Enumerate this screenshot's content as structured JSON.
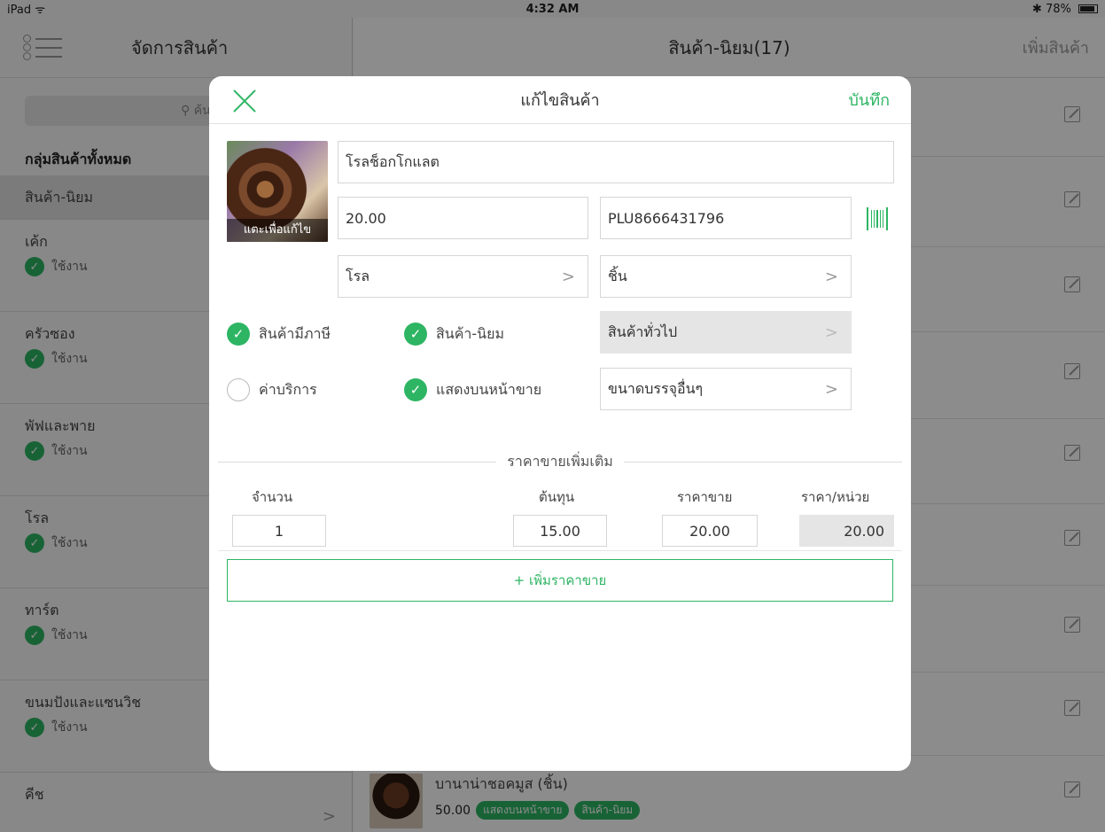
{
  "statusbar": {
    "device": "iPad",
    "wifi": "ᯤ",
    "time": "4:32 AM",
    "bluetooth": "✱",
    "battery": "78%"
  },
  "sidebar": {
    "title": "จัดการสินค้า",
    "search_placeholder": "ค้นหาสิน",
    "all_groups": "กลุ่มสินค้าทั้งหมด",
    "items": [
      {
        "name": "สินค้า-นิยม",
        "state": ""
      },
      {
        "name": "เค้ก",
        "state": "ใช้งาน"
      },
      {
        "name": "ครัวซอง",
        "state": "ใช้งาน"
      },
      {
        "name": "พัฟและพาย",
        "state": "ใช้งาน"
      },
      {
        "name": "โรล",
        "state": "ใช้งาน"
      },
      {
        "name": "ทาร์ต",
        "state": "ใช้งาน"
      },
      {
        "name": "ขนมปังและแซนวิช",
        "state": "ใช้งาน"
      },
      {
        "name": "คีช",
        "state": ""
      }
    ],
    "chevron": ">"
  },
  "main": {
    "title": "สินค้า-นิยม(17)",
    "add_product": "เพิ่มสินค้า",
    "bottom_product": {
      "name": "บานาน่าชอคมูส (ชิ้น)",
      "price": "50.00",
      "chips": [
        "แสดงบนหน้าขาย",
        "สินค้า-นิยม"
      ]
    }
  },
  "modal": {
    "title": "แก้ไขสินค้า",
    "save": "บันทึก",
    "image_caption": "แตะเพื่อแก้ไข",
    "name_value": "โรลช็อกโกแลต",
    "price_value": "20.00",
    "plu_value": "PLU8666431796",
    "category_value": "โรล",
    "unit_value": "ชิ้น",
    "product_type_value": "สินค้าทั่วไป",
    "package_value": "ขนาดบรรจุอื่นๆ",
    "chevron": ">",
    "checkmark": "✓",
    "checks": {
      "taxable": {
        "label": "สินค้ามีภาษี",
        "checked": true
      },
      "popular": {
        "label": "สินค้า-นิยม",
        "checked": true
      },
      "service": {
        "label": "ค่าบริการ",
        "checked": false
      },
      "show_on_sale": {
        "label": "แสดงบนหน้าขาย",
        "checked": true
      }
    },
    "extra_price": {
      "section_title": "ราคาขายเพิ่มเติม",
      "headers": {
        "qty": "จำนวน",
        "cost": "ต้นทุน",
        "price": "ราคาขาย",
        "unit_price": "ราคา/หน่วย"
      },
      "row": {
        "qty": "1",
        "cost": "15.00",
        "price": "20.00",
        "unit_price": "20.00"
      },
      "add_button": "+ เพิ่มราคาขาย"
    }
  }
}
